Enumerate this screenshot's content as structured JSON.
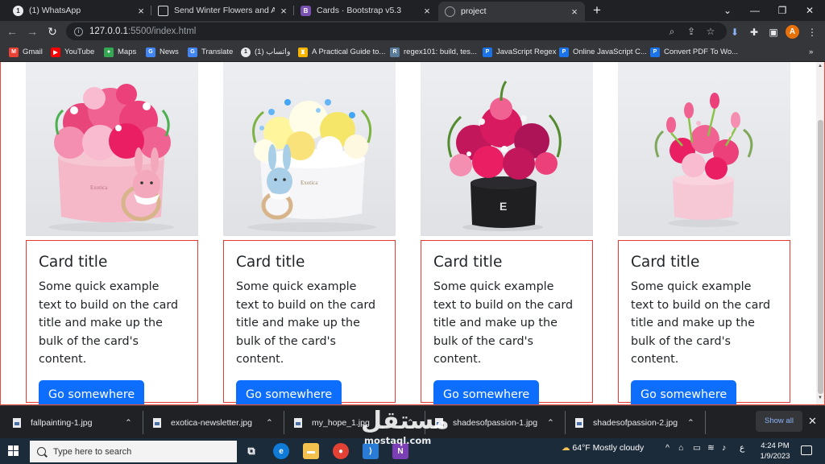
{
  "browser": {
    "tabs": [
      {
        "title": "(1) WhatsApp",
        "favicon": "whatsapp-icon",
        "active": false
      },
      {
        "title": "Send Winter Flowers and Arrange",
        "favicon": "page-icon",
        "active": false
      },
      {
        "title": "Cards · Bootstrap v5.3",
        "favicon": "bootstrap-icon",
        "active": false
      },
      {
        "title": "project",
        "favicon": "globe-icon",
        "active": true
      }
    ],
    "url_host": "127.0.0.1",
    "url_rest": ":5500/index.html",
    "profile_initial": "A",
    "bookmarks": [
      {
        "label": "Gmail",
        "icon": "gmail-icon",
        "color": "#ea4335"
      },
      {
        "label": "YouTube",
        "icon": "youtube-icon",
        "color": "#ff0000"
      },
      {
        "label": "Maps",
        "icon": "maps-icon",
        "color": "#34a853"
      },
      {
        "label": "News",
        "icon": "news-icon",
        "color": "#4285f4"
      },
      {
        "label": "Translate",
        "icon": "translate-icon",
        "color": "#4285f4"
      },
      {
        "label": "واتساب (1)",
        "icon": "whatsapp-icon",
        "color": "#25d366"
      },
      {
        "label": "A Practical Guide to...",
        "icon": "guide-icon",
        "color": "#f4b400"
      },
      {
        "label": "regex101: build, tes...",
        "icon": "regex-icon",
        "color": "#5b7b9a"
      },
      {
        "label": "JavaScript Regex",
        "icon": "p-icon",
        "color": "#1a73e8"
      },
      {
        "label": "Online JavaScript C...",
        "icon": "p-icon",
        "color": "#1a73e8"
      },
      {
        "label": "Convert PDF To Wo...",
        "icon": "p-icon",
        "color": "#1a73e8"
      }
    ]
  },
  "cards": [
    {
      "title": "Card title",
      "text": "Some quick example text to build on the card title and make up the bulk of the card's content.",
      "button": "Go somewhere",
      "image_brand": "Exotica"
    },
    {
      "title": "Card title",
      "text": "Some quick example text to build on the card title and make up the bulk of the card's content.",
      "button": "Go somewhere",
      "image_brand": "Exotica"
    },
    {
      "title": "Card title",
      "text": "Some quick example text to build on the card title and make up the bulk of the card's content.",
      "button": "Go somewhere",
      "image_brand": "E"
    },
    {
      "title": "Card title",
      "text": "Some quick example text to build on the card title and make up the bulk of the card's content.",
      "button": "Go somewhere",
      "image_brand": ""
    }
  ],
  "downloads": {
    "items": [
      {
        "filename": "fallpainting-1.jpg"
      },
      {
        "filename": "exotica-newsletter.jpg"
      },
      {
        "filename": "my_hope_1.jpg"
      },
      {
        "filename": "shadesofpassion-1.jpg"
      },
      {
        "filename": "shadesofpassion-2.jpg"
      }
    ],
    "show_all": "Show all"
  },
  "taskbar": {
    "search_placeholder": "Type here to search",
    "weather": "64°F  Mostly cloudy",
    "lang": "ع",
    "time": "4:24 PM",
    "date": "1/9/2023"
  },
  "watermark": {
    "arabic": "مستقل",
    "latin": "mostaql.com"
  },
  "colors": {
    "accent": "#0d6efd",
    "card_border": "#e53935",
    "chrome_dark": "#202124",
    "chrome_mid": "#35363a"
  }
}
